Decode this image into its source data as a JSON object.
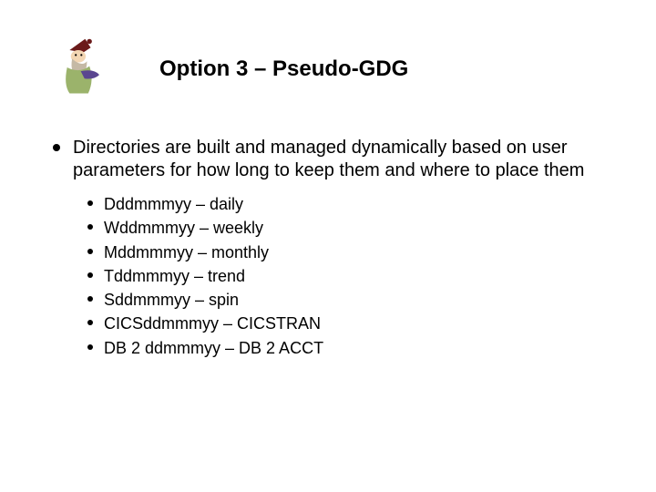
{
  "title": "Option 3 – Pseudo-GDG",
  "bullets": [
    {
      "text": "Directories are built and managed dynamically based on user parameters for how long to keep them and where to place them"
    }
  ],
  "sub_bullets": [
    {
      "text": "Dddmmmyy – daily"
    },
    {
      "text": "Wddmmmyy – weekly"
    },
    {
      "text": "Mddmmmyy – monthly"
    },
    {
      "text": "Tddmmmyy – trend"
    },
    {
      "text": "Sddmmmyy – spin"
    },
    {
      "text": "CICSddmmmyy – CICSTRAN"
    },
    {
      "text": "DB 2 ddmmmyy – DB 2 ACCT"
    }
  ],
  "logo": {
    "name": "wizard-mascot-icon",
    "colors": {
      "hat": "#6b1a1a",
      "face": "#f3d6b3",
      "beard": "#c5b9a5",
      "garment": "#9bb36b",
      "sleeve": "#5a4690"
    }
  }
}
